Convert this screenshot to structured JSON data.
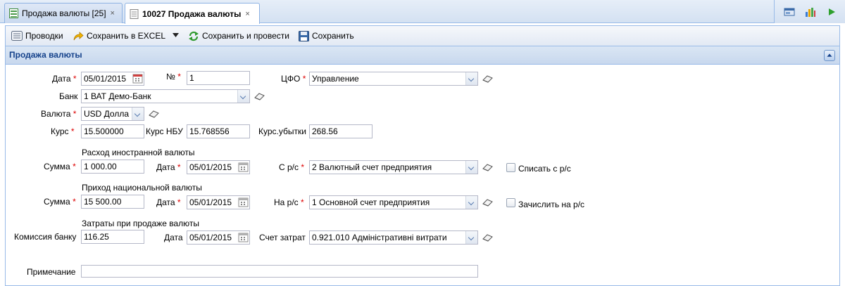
{
  "tabs": [
    {
      "label": "Продажа валюты [25]",
      "close": "×"
    },
    {
      "label": "10027 Продажа валюты",
      "close": "×"
    }
  ],
  "toolbar": {
    "entries": "Проводки",
    "save_excel": "Сохранить в EXCEL",
    "save_post": "Сохранить и провести",
    "save": "Сохранить"
  },
  "panel": {
    "title": "Продажа валюты"
  },
  "form": {
    "date_label": "Дата",
    "date": "05/01/2015",
    "number_label": "№",
    "number": "1",
    "cfo_label": "ЦФО",
    "cfo": "Управление",
    "bank_label": "Банк",
    "bank": "1 ВАТ Демо-Банк",
    "currency_label": "Валюта",
    "currency": "USD Долла",
    "rate_label": "Курс",
    "rate": "15.500000",
    "nbu_label": "Курс НБУ",
    "nbu_rate": "15.768556",
    "loss_label": "Курс.убытки",
    "loss": "268.56",
    "expense_section": "Расход иностранной валюты",
    "sum_label": "Сумма",
    "expense_sum": "1 000.00",
    "expense_date_label": "Дата",
    "expense_date": "05/01/2015",
    "from_acc_label": "С р/с",
    "from_acc": "2 Валютный счет предприятия",
    "writeoff_label": "Списать с р/с",
    "income_section": "Приход национальной валюты",
    "income_sum_label": "Сумма",
    "income_sum": "15 500.00",
    "income_date_label": "Дата",
    "income_date": "05/01/2015",
    "to_acc_label": "На р/с",
    "to_acc": "1 Основной счет предприятия",
    "credit_label": "Зачислить на р/с",
    "costs_section": "Затраты при продаже валюты",
    "commission_label": "Комиссия банку",
    "commission": "116.25",
    "costs_date_label": "Дата",
    "costs_date": "05/01/2015",
    "cost_acc_label": "Счет затрат",
    "cost_acc": "0.921.010 Адміністративні витрати",
    "note_label": "Примечание",
    "note": ""
  },
  "icons": {
    "tab_list": "grid-icon",
    "tab_doc": "document-icon",
    "entries": "list-icon",
    "excel": "export-arrow-icon",
    "save_post": "refresh-green-icon",
    "save": "floppy-icon",
    "cal": "calendar-icon",
    "clear": "eraser-icon"
  },
  "colors": {
    "accent": "#15428b",
    "border": "#99bbe8",
    "required": "#dd0000"
  }
}
